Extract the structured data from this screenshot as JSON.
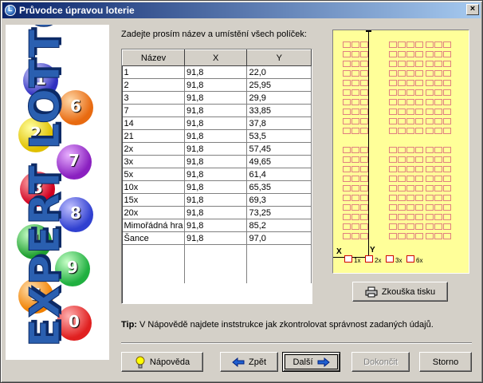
{
  "window": {
    "title": "Průvodce úpravou loterie"
  },
  "instruction": "Zadejte prosím název a umístění všech políček:",
  "table": {
    "headers": [
      "Název",
      "X",
      "Y"
    ],
    "rows": [
      [
        "1",
        "91,8",
        "22,0"
      ],
      [
        "2",
        "91,8",
        "25,95"
      ],
      [
        "3",
        "91,8",
        "29,9"
      ],
      [
        "7",
        "91,8",
        "33,85"
      ],
      [
        "14",
        "91,8",
        "37,8"
      ],
      [
        "21",
        "91,8",
        "53,5"
      ],
      [
        "2x",
        "91,8",
        "57,45"
      ],
      [
        "3x",
        "91,8",
        "49,65"
      ],
      [
        "5x",
        "91,8",
        "61,4"
      ],
      [
        "10x",
        "91,8",
        "65,35"
      ],
      [
        "15x",
        "91,8",
        "69,3"
      ],
      [
        "20x",
        "91,8",
        "73,25"
      ],
      [
        "Mimořádná hra",
        "91,8",
        "85,2"
      ],
      [
        "Šance",
        "91,8",
        "97,0"
      ]
    ]
  },
  "preview": {
    "axis_x": "X",
    "axis_y": "Y",
    "checkboxes": [
      "1x",
      "2x",
      "3x",
      "6x"
    ]
  },
  "print_test_label": "Zkouška tisku",
  "tip": {
    "prefix": "Tip:",
    "text": "V Nápovědě najdete inststrukce jak zkontrolovat správnost zadaných údajů."
  },
  "buttons": {
    "help": "Nápověda",
    "back": "Zpět",
    "next": "Další",
    "finish": "Dokončit",
    "cancel": "Storno"
  },
  "logo": {
    "text": "EXPERT LOTTO",
    "balls": [
      "1",
      "6",
      "2",
      "7",
      "3",
      "8",
      "4",
      "9",
      "5",
      "0"
    ]
  }
}
